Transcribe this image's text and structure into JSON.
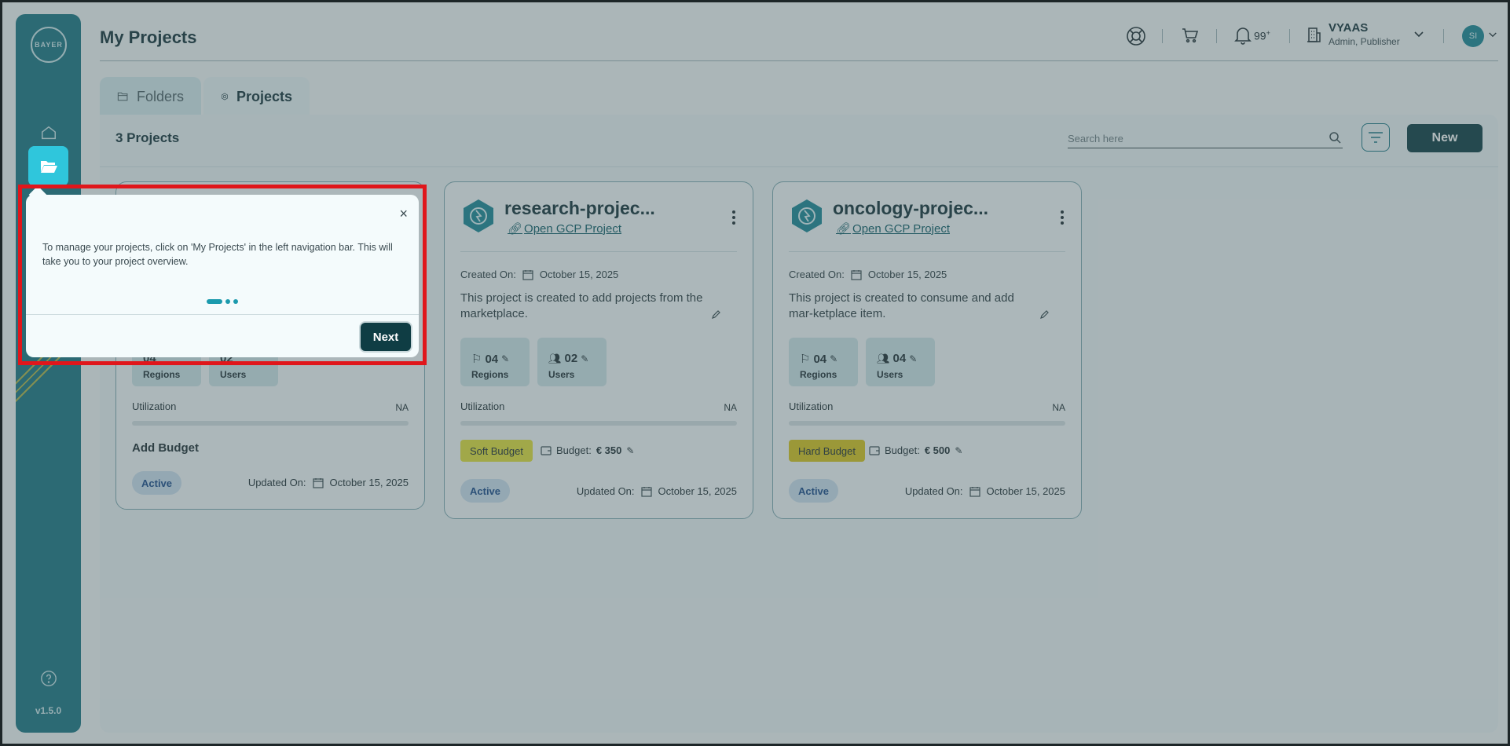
{
  "app": {
    "logo_text_h": "BAYER",
    "logo_text_v": "BAYER",
    "version": "v1.5.0"
  },
  "header": {
    "title": "My Projects",
    "notifications": "99",
    "notifications_sup": "+",
    "user_name": "VYAAS",
    "user_role": "Admin, Publisher",
    "avatar_initials": "SI"
  },
  "tabs": [
    {
      "label": "Folders"
    },
    {
      "label": "Projects"
    }
  ],
  "toolbar": {
    "count_title": "3 Projects",
    "search_placeholder": "Search here",
    "new_label": "New"
  },
  "projects": [
    {
      "regions": "04",
      "regions_label": "Regions",
      "users": "02",
      "users_label": "Users",
      "utilization_label": "Utilization",
      "utilization_value": "NA",
      "add_budget": "Add Budget",
      "status": "Active",
      "updated_label": "Updated On:",
      "updated_date": "October 15, 2025"
    },
    {
      "name": "research-projec...",
      "gcp_link": "Open GCP Project",
      "created_label": "Created On:",
      "created_date": "October 15, 2025",
      "description": "This project is created to add projects from the marketplace.",
      "regions": "04",
      "regions_label": "Regions",
      "users": "02",
      "users_label": "Users",
      "utilization_label": "Utilization",
      "utilization_value": "NA",
      "budget_type": "Soft Budget",
      "budget_label": "Budget:",
      "budget_amount": "€ 350",
      "status": "Active",
      "updated_label": "Updated On:",
      "updated_date": "October 15, 2025"
    },
    {
      "name": "oncology-projec...",
      "gcp_link": "Open GCP Project",
      "created_label": "Created On:",
      "created_date": "October 15, 2025",
      "description": "This project is created to consume and add mar-ketplace item.",
      "regions": "04",
      "regions_label": "Regions",
      "users": "04",
      "users_label": "Users",
      "utilization_label": "Utilization",
      "utilization_value": "NA",
      "budget_type": "Hard Budget",
      "budget_label": "Budget:",
      "budget_amount": "€ 500",
      "status": "Active",
      "updated_label": "Updated On:",
      "updated_date": "October 15, 2025"
    }
  ],
  "tour": {
    "text": "To manage your projects, click on 'My Projects' in the left navigation bar. This will take you to your project overview.",
    "close_label": "×",
    "next_label": "Next"
  },
  "colors": {
    "sidebar": "#1b7683",
    "active_nav": "#2fc6dc",
    "primary_button": "#0f3d44",
    "soft_budget": "#e3e03a",
    "hard_budget": "#d9c51c",
    "highlight": "#e0161b"
  }
}
